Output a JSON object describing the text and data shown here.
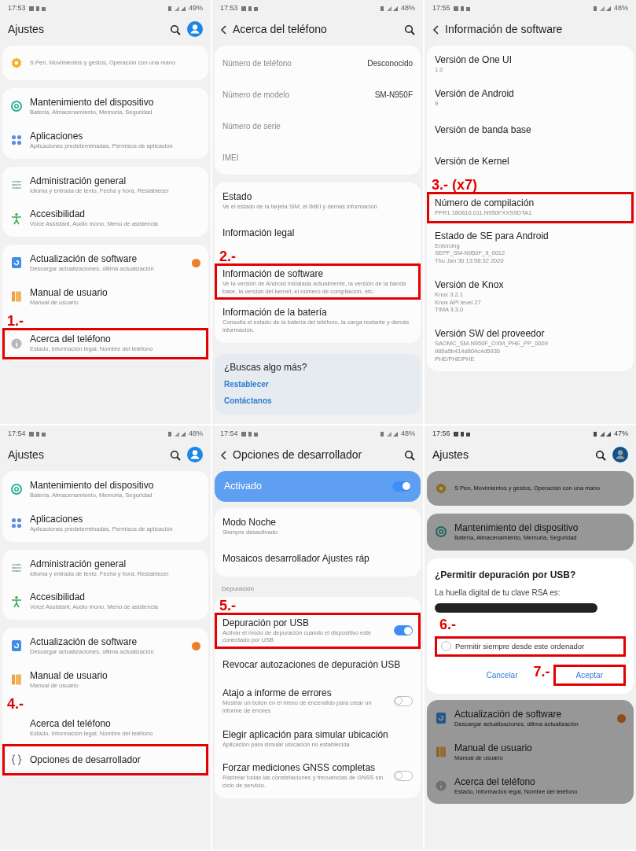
{
  "panels": [
    {
      "status_bar": {
        "time": "17:53",
        "battery": "49%"
      },
      "header": {
        "title": "Ajustes",
        "back": false,
        "search": true,
        "avatar": true
      },
      "dimmed": false,
      "groups": [
        {
          "kind": "card",
          "items": [
            {
              "kind": "advanced",
              "subtitle": "S Pen, Movimientos y gestos, Operación con una mano"
            }
          ]
        },
        {
          "kind": "card",
          "items": [
            {
              "kind": "maintenance",
              "title": "Mantenimiento del dispositivo",
              "subtitle": "Batería, Almacenamiento, Memoria, Seguridad"
            },
            {
              "kind": "apps",
              "title": "Aplicaciones",
              "subtitle": "Aplicaciones predeterminadas, Permisos de aplicación"
            }
          ]
        },
        {
          "kind": "card",
          "items": [
            {
              "kind": "general",
              "title": "Administración general",
              "subtitle": "Idioma y entrada de texto, Fecha y hora, Restablecer"
            },
            {
              "kind": "accessibility",
              "title": "Accesibilidad",
              "subtitle": "Voice Assistant, Audio mono, Menú de asistencia"
            }
          ]
        },
        {
          "kind": "card",
          "items": [
            {
              "kind": "update",
              "title": "Actualización de software",
              "subtitle": "Descargar actualizaciones, última actualización",
              "badge": true
            },
            {
              "kind": "manual",
              "title": "Manual de usuario",
              "subtitle": "Manual de usuario"
            },
            {
              "kind": "about",
              "title": "Acerca del teléfono",
              "subtitle": "Estado, Información legal, Nombre del teléfono",
              "highlighted": true,
              "step": "1.-"
            }
          ]
        }
      ]
    },
    {
      "status_bar": {
        "time": "17:53",
        "battery": "48%"
      },
      "header": {
        "title": "Acerca del teléfono",
        "back": true,
        "search": true,
        "avatar": false
      },
      "dimmed": false,
      "groups": [
        {
          "kind": "card",
          "items": [
            {
              "kind": "info",
              "title": "Número de teléfono",
              "value": "Desconocido"
            },
            {
              "kind": "info",
              "title": "Número de modelo",
              "value": "SM-N950F"
            },
            {
              "kind": "info",
              "title": "Número de serie"
            },
            {
              "kind": "info",
              "title": "IMEI"
            }
          ]
        },
        {
          "kind": "card",
          "items": [
            {
              "kind": "nav",
              "title": "Estado",
              "subtitle": "Ve el estado de la tarjeta SIM, el IMEI y demás información"
            },
            {
              "kind": "nav",
              "title": "Información legal"
            },
            {
              "kind": "nav",
              "title": "Información de software",
              "subtitle": "Ve la versión de Android instalada actualmente, la versión de la banda base, la versión del kernel, el número de compilación, etc.",
              "highlighted": true,
              "step": "2.-"
            },
            {
              "kind": "nav",
              "title": "Información de la batería",
              "subtitle": "Consulta el estado de la batería del teléfono, la carga restante y demás información."
            }
          ]
        },
        {
          "kind": "links",
          "title": "¿Buscas algo más?",
          "links": [
            "Restablecer",
            "Contáctanos"
          ]
        }
      ]
    },
    {
      "status_bar": {
        "time": "17:55",
        "battery": "48%"
      },
      "header": {
        "title": "Información de software",
        "back": true,
        "search": false,
        "avatar": false
      },
      "dimmed": false,
      "groups": [
        {
          "kind": "card",
          "items": [
            {
              "kind": "nav",
              "title": "Versión de One UI",
              "subtitle": "1.0"
            },
            {
              "kind": "nav",
              "title": "Versión de Android",
              "subtitle": "9"
            },
            {
              "kind": "nav",
              "title": "Versión de banda base"
            },
            {
              "kind": "nav",
              "title": "Versión de Kernel"
            },
            {
              "kind": "nav",
              "title": "Número de compilación",
              "subtitle": "PPR1.180610.011.N950FXXS9DTA1",
              "highlighted": true,
              "step": "3.- (x7)"
            },
            {
              "kind": "nav",
              "title": "Estado de SE para Android",
              "lines": [
                "Enforcing",
                "SEPF_SM-N950F_9_0012",
                "Thu Jan 30 13:58:32 2020"
              ]
            },
            {
              "kind": "nav",
              "title": "Versión de Knox",
              "lines": [
                "Knox 3.2.1",
                "Knox API level 27",
                "TIMA 3.3.0"
              ]
            },
            {
              "kind": "nav",
              "title": "Versión SW del proveedor",
              "lines": [
                "SAOMC_SM-N950F_OXM_PHE_PP_0009",
                "988a5b414d804c4d5930",
                "PHE/PHE/PHE"
              ]
            }
          ]
        }
      ]
    },
    {
      "status_bar": {
        "time": "17:54",
        "battery": "48%"
      },
      "header": {
        "title": "Ajustes",
        "back": false,
        "search": true,
        "avatar": true
      },
      "dimmed": false,
      "groups": [
        {
          "kind": "card",
          "items": [
            {
              "kind": "maintenance",
              "title": "Mantenimiento del dispositivo",
              "subtitle": "Batería, Almacenamiento, Memoria, Seguridad"
            },
            {
              "kind": "apps",
              "title": "Aplicaciones",
              "subtitle": "Aplicaciones predeterminadas, Permisos de aplicación"
            }
          ]
        },
        {
          "kind": "card",
          "items": [
            {
              "kind": "general",
              "title": "Administración general",
              "subtitle": "Idioma y entrada de texto, Fecha y hora, Restablecer"
            },
            {
              "kind": "accessibility",
              "title": "Accesibilidad",
              "subtitle": "Voice Assistant, Audio mono, Menú de asistencia"
            }
          ]
        },
        {
          "kind": "card",
          "items": [
            {
              "kind": "update",
              "title": "Actualización de software",
              "subtitle": "Descargar actualizaciones, última actualización",
              "badge": true
            },
            {
              "kind": "manual",
              "title": "Manual de usuario",
              "subtitle": "Manual de usuario"
            },
            {
              "kind": "nav",
              "title": "Acerca del teléfono",
              "subtitle": "Estado, Información legal, Nombre del teléfono",
              "step": "4.-"
            },
            {
              "kind": "developer",
              "title": "Opciones de desarrollador",
              "highlighted": true
            }
          ]
        }
      ]
    },
    {
      "status_bar": {
        "time": "17:54",
        "battery": "48%"
      },
      "header": {
        "title": "Opciones de desarrollador",
        "back": true,
        "search": true,
        "avatar": false
      },
      "dimmed": false,
      "groups": [
        {
          "kind": "master",
          "title": "Activado",
          "on": true
        },
        {
          "kind": "card",
          "items": [
            {
              "kind": "nav",
              "title": "Modo Noche",
              "subtitle": "Siempre desactivado"
            },
            {
              "kind": "nav",
              "title": "Mosaicos desarrollador Ajustes ráp"
            }
          ]
        },
        {
          "kind": "section",
          "title": "Depuración"
        },
        {
          "kind": "card",
          "items": [
            {
              "kind": "toggle",
              "title": "Depuración por USB",
              "subtitle": "Activar el modo de depuración cuando el dispositivo esté conectado por USB",
              "on": true,
              "highlighted": true,
              "step": "5.-"
            },
            {
              "kind": "nav",
              "title": "Revocar autozaciones de depuración USB"
            },
            {
              "kind": "toggle",
              "title": "Atajo a informe de errores",
              "subtitle": "Mostrar un botón en el menú de encendido para crear un informe de errores",
              "on": false
            },
            {
              "kind": "nav",
              "title": "Elegir aplicación para simular ubicación",
              "subtitle": "Aplicación para simular ubicación no establecida"
            },
            {
              "kind": "toggle",
              "title": "Forzar mediciones GNSS completas",
              "subtitle": "Rastrear todas las constelaciones y frecuencias de GNSS sin ciclo de servicio.",
              "on": false
            }
          ]
        }
      ]
    },
    {
      "status_bar": {
        "time": "17:56",
        "battery": "47%"
      },
      "header": {
        "title": "Ajustes",
        "back": false,
        "search": true,
        "avatar": true
      },
      "dimmed": true,
      "groups": [
        {
          "kind": "card",
          "items": [
            {
              "kind": "advanced",
              "subtitle": "S Pen, Movimientos y gestos, Operación con una mano"
            }
          ]
        },
        {
          "kind": "card",
          "items": [
            {
              "kind": "maintenance",
              "title": "Mantenimiento del dispositivo",
              "subtitle": "Batería, Almacenamiento, Memoria, Seguridad"
            }
          ]
        },
        {
          "kind": "dialog",
          "title": "¿Permitir depuración por USB?",
          "message": "La huella digital de tu clave RSA es:",
          "redacted": true,
          "checkbox": {
            "label": "Permitir siempre desde este ordenador",
            "checked": false,
            "highlighted": true,
            "step": "6.-"
          },
          "buttons": [
            {
              "label": "Cancelar",
              "highlighted": false
            },
            {
              "label": "Aceptar",
              "highlighted": true,
              "step": "7.-"
            }
          ]
        },
        {
          "kind": "card",
          "items": [
            {
              "kind": "update",
              "title": "Actualización de software",
              "subtitle": "Descargar actualizaciones, última actualización",
              "badge": true
            },
            {
              "kind": "manual",
              "title": "Manual de usuario",
              "subtitle": "Manual de usuario"
            },
            {
              "kind": "about",
              "title": "Acerca del teléfono",
              "subtitle": "Estado, Información legal, Nombre del teléfono"
            }
          ]
        }
      ]
    }
  ]
}
